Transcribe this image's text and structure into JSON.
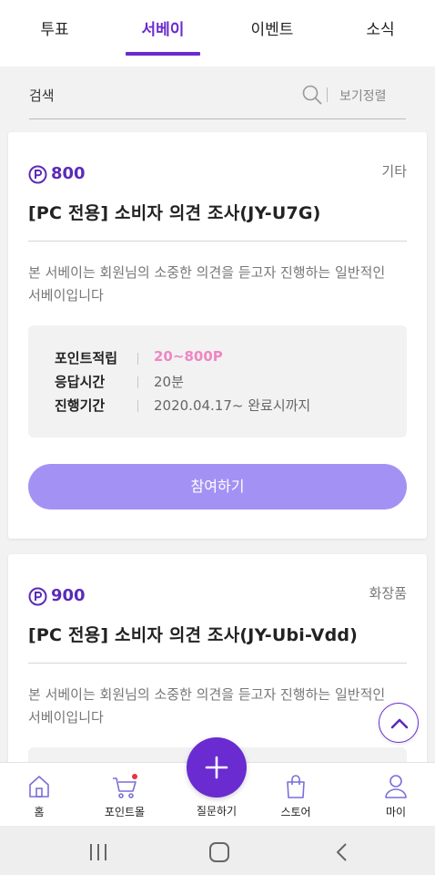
{
  "tabs": [
    {
      "label": "투표",
      "active": false
    },
    {
      "label": "서베이",
      "active": true
    },
    {
      "label": "이벤트",
      "active": false
    },
    {
      "label": "소식",
      "active": false
    }
  ],
  "search": {
    "placeholder": "검색",
    "sort_label": "보기정렬",
    "icon": "search-icon"
  },
  "surveys": [
    {
      "points": "800",
      "category": "기타",
      "title": "[PC 전용] 소비자 의견 조사(JY-U7G)",
      "description": "본 서베이는 회원님의 소중한 의견을 듣고자 진행하는 일반적인 서베이입니다",
      "info": [
        {
          "label": "포인트적립",
          "value": "20~800P"
        },
        {
          "label": "응답시간",
          "value": "20분"
        },
        {
          "label": "진행기간",
          "value": "2020.04.17~ 완료시까지"
        }
      ],
      "button_label": "참여하기"
    },
    {
      "points": "900",
      "category": "화장품",
      "title": "[PC 전용] 소비자 의견 조사(JY-Ubi-Vdd)",
      "description": "본 서베이는 회원님의 소중한 의견을 듣고자 진행하는 일반적인 서베이입니다"
    }
  ],
  "bottom_nav": {
    "items": [
      {
        "label": "홈",
        "icon": "home-icon"
      },
      {
        "label": "포인트몰",
        "icon": "cart-icon"
      },
      {
        "label": "질문하기",
        "icon": "plus-icon"
      },
      {
        "label": "스토어",
        "icon": "shopping-bag-icon"
      },
      {
        "label": "마이",
        "icon": "person-icon"
      }
    ]
  },
  "colors": {
    "accent": "#6a2bd0",
    "button": "#a392f4",
    "points_pink": "#ef86c3"
  }
}
